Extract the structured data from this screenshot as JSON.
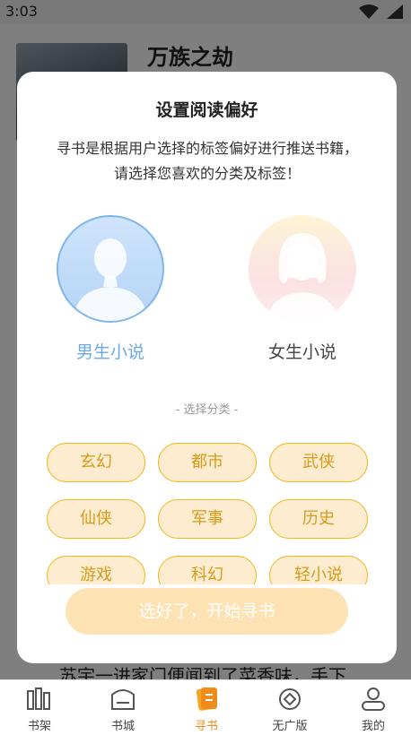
{
  "status_bar": {
    "time": "3:03"
  },
  "background": {
    "book_title": "万族之劫",
    "snippet": "苏宇一进家门便闻到了菜香味，手下"
  },
  "modal": {
    "title": "设置阅读偏好",
    "description": "寻书是根据用户选择的标签偏好进行推送书籍， 请选择您喜欢的分类及标签！",
    "male_label": "男生小说",
    "female_label": "女生小说",
    "section_label": "- 选择分类 -",
    "tags": [
      "玄幻",
      "都市",
      "武侠",
      "仙侠",
      "军事",
      "历史",
      "游戏",
      "科幻",
      "轻小说"
    ],
    "confirm_button": "选好了，开始寻书"
  },
  "tabbar": {
    "items": [
      {
        "label": "书架",
        "icon": "bookshelf-icon"
      },
      {
        "label": "书城",
        "icon": "bookstore-icon"
      },
      {
        "label": "寻书",
        "icon": "find-books-icon"
      },
      {
        "label": "无广版",
        "icon": "ad-free-icon"
      },
      {
        "label": "我的",
        "icon": "profile-icon"
      }
    ],
    "active_index": 2
  },
  "colors": {
    "accent_orange": "#f08c1a",
    "tag_border": "#f2b51a",
    "tag_fill": "#fdeccf",
    "male_blue": "#6aa9e6"
  }
}
